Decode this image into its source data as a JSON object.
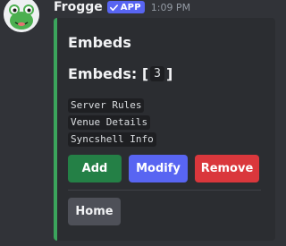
{
  "message": {
    "author": "Frogge",
    "app_tag": "APP",
    "timestamp": "1:09 PM",
    "avatar_icon": "frog-avatar-icon",
    "embed_accent": "#3ba55c"
  },
  "embed": {
    "title": "Embeds",
    "count_prefix": "Embeds: [",
    "count": "3",
    "count_suffix": "]",
    "items": [
      "Server Rules",
      "Venue Details",
      "Syncshell Info"
    ]
  },
  "buttons": {
    "add": "Add",
    "modify": "Modify",
    "remove": "Remove",
    "home": "Home"
  },
  "colors": {
    "background": "#313338",
    "embed_background": "#2b2d31",
    "add": "#248046",
    "modify": "#5865f2",
    "remove": "#da373c",
    "home": "#4e5058"
  }
}
